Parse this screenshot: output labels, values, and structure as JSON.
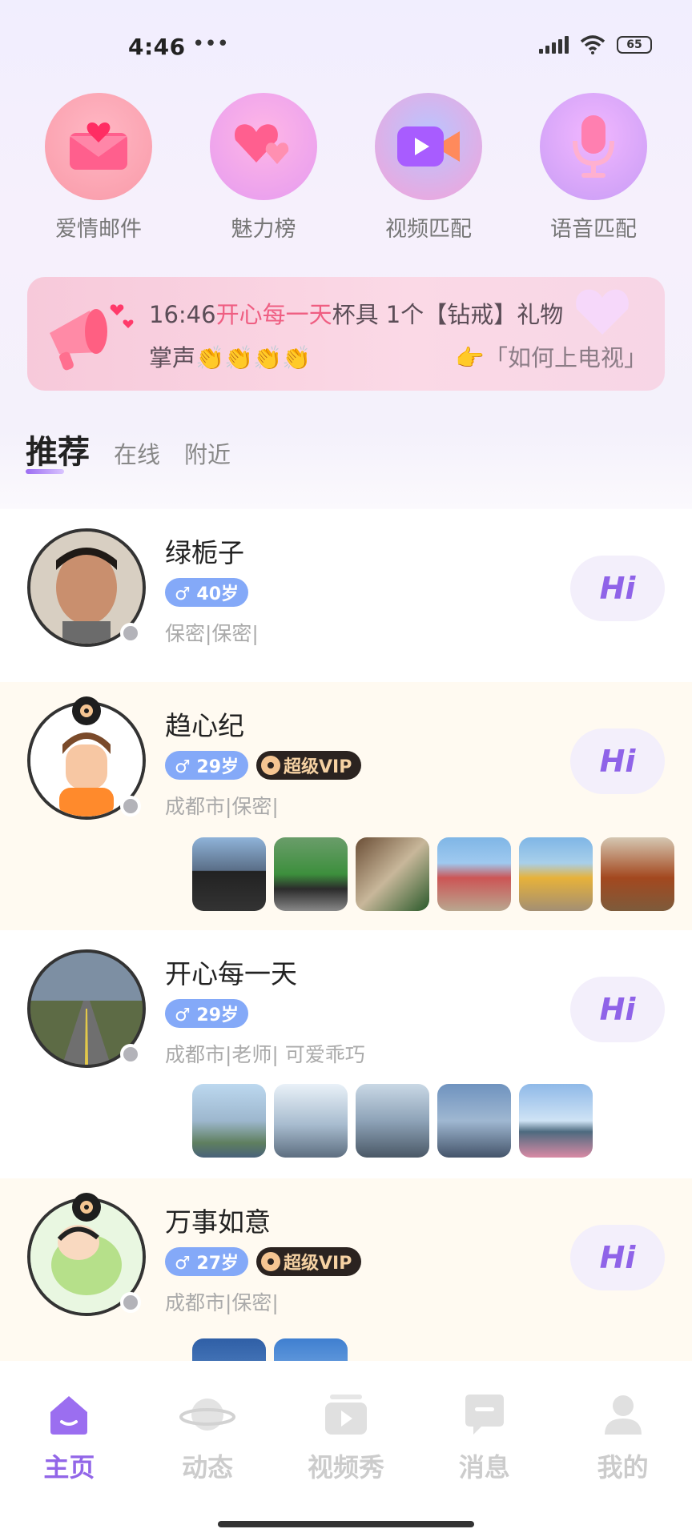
{
  "status": {
    "time": "4:46",
    "dots": "•••",
    "battery": "65"
  },
  "quick": [
    {
      "label": "爱情邮件",
      "icon": "love-letter-icon"
    },
    {
      "label": "魅力榜",
      "icon": "hearts-icon"
    },
    {
      "label": "视频匹配",
      "icon": "video-camera-icon"
    },
    {
      "label": "语音匹配",
      "icon": "microphone-icon"
    }
  ],
  "banner": {
    "time": "16:46",
    "name": "开心每一天",
    "rest": "杯具 1个【钻戒】礼物",
    "applause": "掌声👏👏👏👏",
    "link": "👉「如何上电视」"
  },
  "tabs": {
    "recommend": "推荐",
    "online": "在线",
    "nearby": "附近"
  },
  "users": [
    {
      "name": "绿栀子",
      "age": "♂ 40岁",
      "vip": "",
      "info": "保密|保密|",
      "hi": "Hi"
    },
    {
      "name": "趋心纪",
      "age": "♂ 29岁",
      "vip": "超级VIP",
      "info": "成都市|保密|",
      "hi": "Hi"
    },
    {
      "name": "开心每一天",
      "age": "♂ 29岁",
      "vip": "",
      "info": "成都市|老师| 可爱乖巧",
      "hi": "Hi"
    },
    {
      "name": "万事如意",
      "age": "♂ 27岁",
      "vip": "超级VIP",
      "info": "成都市|保密|",
      "hi": "Hi"
    }
  ],
  "nav": {
    "home": "主页",
    "feed": "动态",
    "video": "视频秀",
    "message": "消息",
    "mine": "我的"
  },
  "colors": {
    "accent": "#9266e8",
    "highlight": "#ef5e82",
    "age_badge": "#84a9f8"
  }
}
